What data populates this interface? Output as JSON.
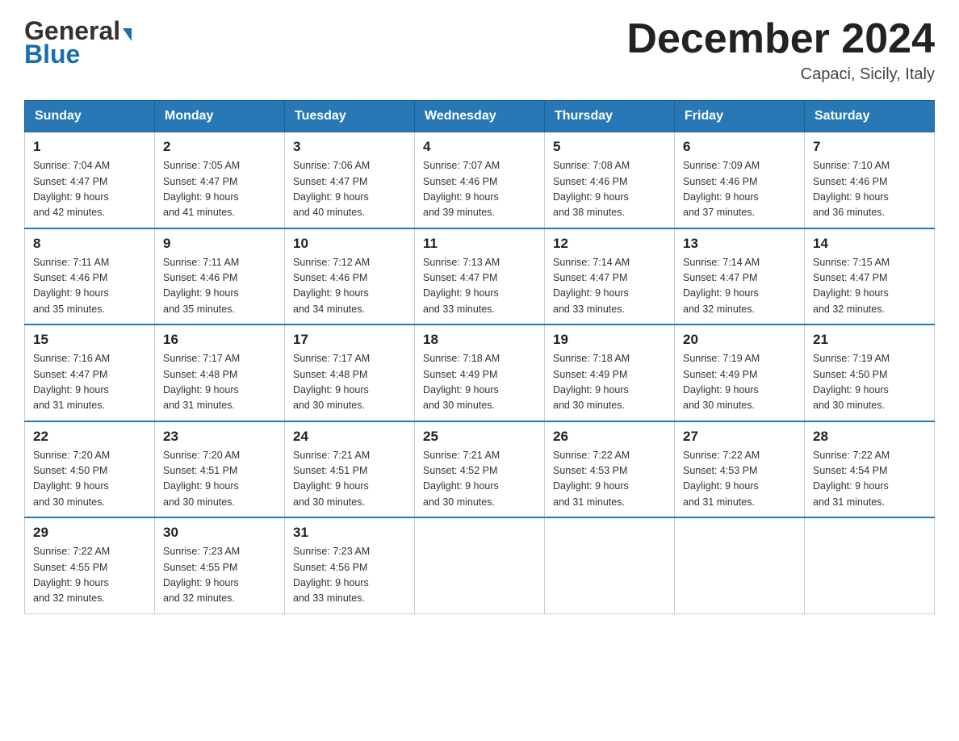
{
  "header": {
    "logo_general": "General",
    "logo_blue": "Blue",
    "month_title": "December 2024",
    "location": "Capaci, Sicily, Italy"
  },
  "days_of_week": [
    "Sunday",
    "Monday",
    "Tuesday",
    "Wednesday",
    "Thursday",
    "Friday",
    "Saturday"
  ],
  "weeks": [
    [
      {
        "day": "1",
        "sunrise": "7:04 AM",
        "sunset": "4:47 PM",
        "daylight": "9 hours and 42 minutes."
      },
      {
        "day": "2",
        "sunrise": "7:05 AM",
        "sunset": "4:47 PM",
        "daylight": "9 hours and 41 minutes."
      },
      {
        "day": "3",
        "sunrise": "7:06 AM",
        "sunset": "4:47 PM",
        "daylight": "9 hours and 40 minutes."
      },
      {
        "day": "4",
        "sunrise": "7:07 AM",
        "sunset": "4:46 PM",
        "daylight": "9 hours and 39 minutes."
      },
      {
        "day": "5",
        "sunrise": "7:08 AM",
        "sunset": "4:46 PM",
        "daylight": "9 hours and 38 minutes."
      },
      {
        "day": "6",
        "sunrise": "7:09 AM",
        "sunset": "4:46 PM",
        "daylight": "9 hours and 37 minutes."
      },
      {
        "day": "7",
        "sunrise": "7:10 AM",
        "sunset": "4:46 PM",
        "daylight": "9 hours and 36 minutes."
      }
    ],
    [
      {
        "day": "8",
        "sunrise": "7:11 AM",
        "sunset": "4:46 PM",
        "daylight": "9 hours and 35 minutes."
      },
      {
        "day": "9",
        "sunrise": "7:11 AM",
        "sunset": "4:46 PM",
        "daylight": "9 hours and 35 minutes."
      },
      {
        "day": "10",
        "sunrise": "7:12 AM",
        "sunset": "4:46 PM",
        "daylight": "9 hours and 34 minutes."
      },
      {
        "day": "11",
        "sunrise": "7:13 AM",
        "sunset": "4:47 PM",
        "daylight": "9 hours and 33 minutes."
      },
      {
        "day": "12",
        "sunrise": "7:14 AM",
        "sunset": "4:47 PM",
        "daylight": "9 hours and 33 minutes."
      },
      {
        "day": "13",
        "sunrise": "7:14 AM",
        "sunset": "4:47 PM",
        "daylight": "9 hours and 32 minutes."
      },
      {
        "day": "14",
        "sunrise": "7:15 AM",
        "sunset": "4:47 PM",
        "daylight": "9 hours and 32 minutes."
      }
    ],
    [
      {
        "day": "15",
        "sunrise": "7:16 AM",
        "sunset": "4:47 PM",
        "daylight": "9 hours and 31 minutes."
      },
      {
        "day": "16",
        "sunrise": "7:17 AM",
        "sunset": "4:48 PM",
        "daylight": "9 hours and 31 minutes."
      },
      {
        "day": "17",
        "sunrise": "7:17 AM",
        "sunset": "4:48 PM",
        "daylight": "9 hours and 30 minutes."
      },
      {
        "day": "18",
        "sunrise": "7:18 AM",
        "sunset": "4:49 PM",
        "daylight": "9 hours and 30 minutes."
      },
      {
        "day": "19",
        "sunrise": "7:18 AM",
        "sunset": "4:49 PM",
        "daylight": "9 hours and 30 minutes."
      },
      {
        "day": "20",
        "sunrise": "7:19 AM",
        "sunset": "4:49 PM",
        "daylight": "9 hours and 30 minutes."
      },
      {
        "day": "21",
        "sunrise": "7:19 AM",
        "sunset": "4:50 PM",
        "daylight": "9 hours and 30 minutes."
      }
    ],
    [
      {
        "day": "22",
        "sunrise": "7:20 AM",
        "sunset": "4:50 PM",
        "daylight": "9 hours and 30 minutes."
      },
      {
        "day": "23",
        "sunrise": "7:20 AM",
        "sunset": "4:51 PM",
        "daylight": "9 hours and 30 minutes."
      },
      {
        "day": "24",
        "sunrise": "7:21 AM",
        "sunset": "4:51 PM",
        "daylight": "9 hours and 30 minutes."
      },
      {
        "day": "25",
        "sunrise": "7:21 AM",
        "sunset": "4:52 PM",
        "daylight": "9 hours and 30 minutes."
      },
      {
        "day": "26",
        "sunrise": "7:22 AM",
        "sunset": "4:53 PM",
        "daylight": "9 hours and 31 minutes."
      },
      {
        "day": "27",
        "sunrise": "7:22 AM",
        "sunset": "4:53 PM",
        "daylight": "9 hours and 31 minutes."
      },
      {
        "day": "28",
        "sunrise": "7:22 AM",
        "sunset": "4:54 PM",
        "daylight": "9 hours and 31 minutes."
      }
    ],
    [
      {
        "day": "29",
        "sunrise": "7:22 AM",
        "sunset": "4:55 PM",
        "daylight": "9 hours and 32 minutes."
      },
      {
        "day": "30",
        "sunrise": "7:23 AM",
        "sunset": "4:55 PM",
        "daylight": "9 hours and 32 minutes."
      },
      {
        "day": "31",
        "sunrise": "7:23 AM",
        "sunset": "4:56 PM",
        "daylight": "9 hours and 33 minutes."
      },
      null,
      null,
      null,
      null
    ]
  ],
  "labels": {
    "sunrise": "Sunrise:",
    "sunset": "Sunset:",
    "daylight": "Daylight:"
  }
}
